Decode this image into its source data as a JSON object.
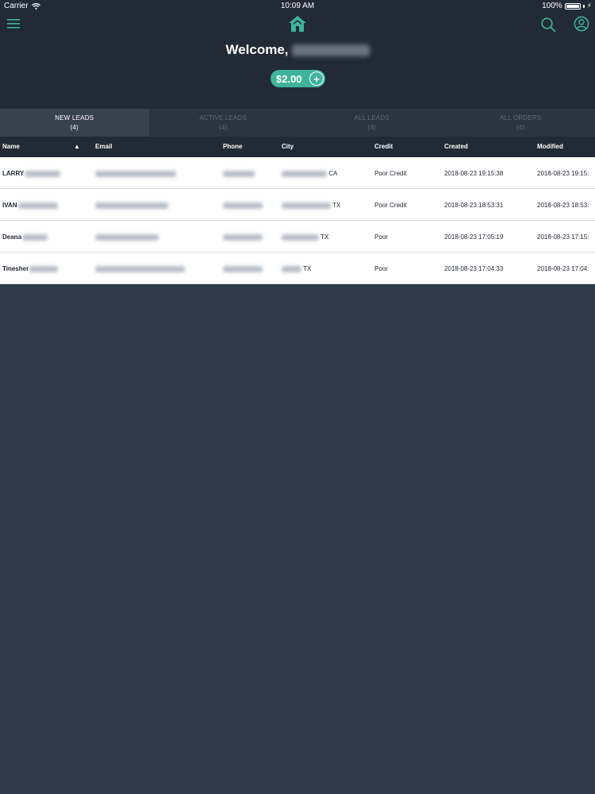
{
  "status_bar": {
    "carrier": "Carrier",
    "time": "10:09 AM",
    "battery": "100%"
  },
  "header": {
    "welcome_text": "Welcome,",
    "balance": "$2.00",
    "balance_add": "+"
  },
  "tabs": [
    {
      "label": "NEW LEADS",
      "count": "(4)",
      "active": true
    },
    {
      "label": "ACTIVE LEADS",
      "count": "(4)",
      "active": false
    },
    {
      "label": "ALL LEADS",
      "count": "(4)",
      "active": false
    },
    {
      "label": "ALL ORDERS",
      "count": "(4)",
      "active": false
    }
  ],
  "table": {
    "columns": {
      "name": "Name",
      "email": "Email",
      "phone": "Phone",
      "city": "City",
      "credit": "Credit",
      "created": "Created",
      "modified": "Modified"
    },
    "sort_indicator": "▲",
    "rows": [
      {
        "name": "LARRY",
        "state": "CA",
        "credit": "Poor Credit",
        "created": "2018-08-23 19:15:38",
        "modified": "2018-08-23 19:15:"
      },
      {
        "name": "IVAN",
        "state": "TX",
        "credit": "Poor Credit",
        "created": "2018-08-23 18:53:31",
        "modified": "2018-08-23 18:53:"
      },
      {
        "name": "Deana",
        "state": "TX",
        "credit": "Poor",
        "created": "2018-08-23 17:05:19",
        "modified": "2018-08-23 17:15:"
      },
      {
        "name": "Tinesher",
        "state": "TX",
        "credit": "Poor",
        "created": "2018-08-23 17:04:33",
        "modified": "2018-08-23 17:04:"
      }
    ]
  },
  "colors": {
    "accent": "#3fb39c",
    "header_bg": "#222a36",
    "body_bg": "#2f3a48"
  },
  "icons": {
    "menu": "menu-icon",
    "home": "home-icon",
    "search": "search-icon",
    "profile": "profile-icon"
  }
}
